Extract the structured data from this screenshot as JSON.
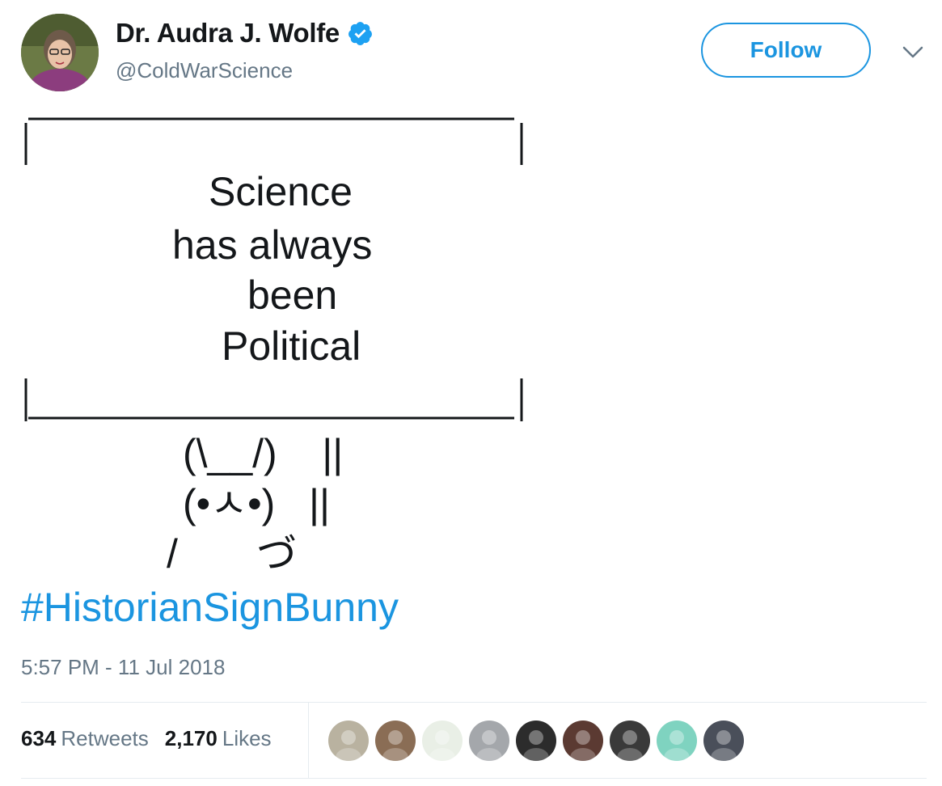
{
  "author": {
    "display_name": "Dr. Audra J. Wolfe",
    "handle": "@ColdWarScience",
    "verified": true,
    "verified_color": "#1da1f2"
  },
  "follow_button": {
    "label": "Follow"
  },
  "menu": {
    "icon": "chevron-down-icon"
  },
  "tweet": {
    "sign_top": "_________________________",
    "sign_lines": [
      "Science",
      "has always",
      "been",
      "Political"
    ],
    "sign_bottom": "|________________________|",
    "bunny_lines": [
      "(\\__/)    ||",
      "(•ㅅ•)   ||",
      "/       づ"
    ],
    "hashtag": "#HistorianSignBunny",
    "timestamp": "5:57 PM - 11 Jul 2018"
  },
  "stats": {
    "retweets_count": "634",
    "retweets_label": "Retweets",
    "likes_count": "2,170",
    "likes_label": "Likes"
  },
  "liker_avatars": [
    {
      "name": "liker-avatar-1",
      "color": "#b9b2a0"
    },
    {
      "name": "liker-avatar-2",
      "color": "#8a6d55"
    },
    {
      "name": "liker-avatar-3",
      "color": "#e9efe6"
    },
    {
      "name": "liker-avatar-4",
      "color": "#a4a7ab"
    },
    {
      "name": "liker-avatar-5",
      "color": "#2c2c2c"
    },
    {
      "name": "liker-avatar-6",
      "color": "#5b3a32"
    },
    {
      "name": "liker-avatar-7",
      "color": "#3a3a3a"
    },
    {
      "name": "liker-avatar-8",
      "color": "#7fd3c0"
    },
    {
      "name": "liker-avatar-9",
      "color": "#4a4f5a"
    }
  ],
  "colors": {
    "link": "#1b95e0",
    "secondary_text": "#657786",
    "divider": "#e6ecf0"
  }
}
